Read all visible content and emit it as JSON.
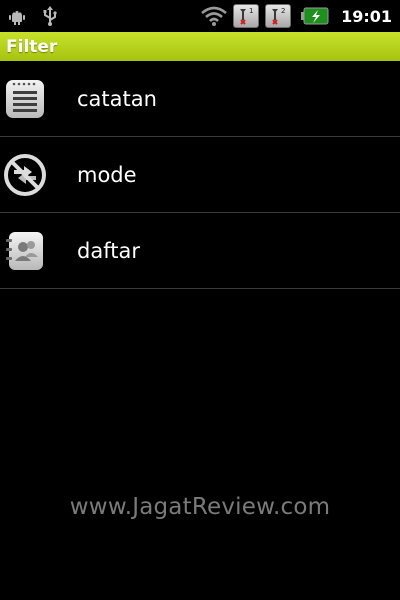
{
  "status_bar": {
    "left_icons": [
      "android-debug-icon",
      "usb-icon"
    ],
    "right_icons": [
      "wifi-icon",
      "sim1-no-signal-icon",
      "sim2-no-signal-icon",
      "battery-charging-icon"
    ],
    "sim1_label": "1",
    "sim2_label": "2",
    "time": "19:01"
  },
  "title_bar": {
    "title": "Filter",
    "accent_color": "#b4d019"
  },
  "list": {
    "items": [
      {
        "label": "catatan",
        "icon": "notes-icon"
      },
      {
        "label": "mode",
        "icon": "mode-icon"
      },
      {
        "label": "daftar",
        "icon": "contacts-list-icon"
      }
    ]
  },
  "watermark": {
    "text": "www.JagatReview.com"
  }
}
